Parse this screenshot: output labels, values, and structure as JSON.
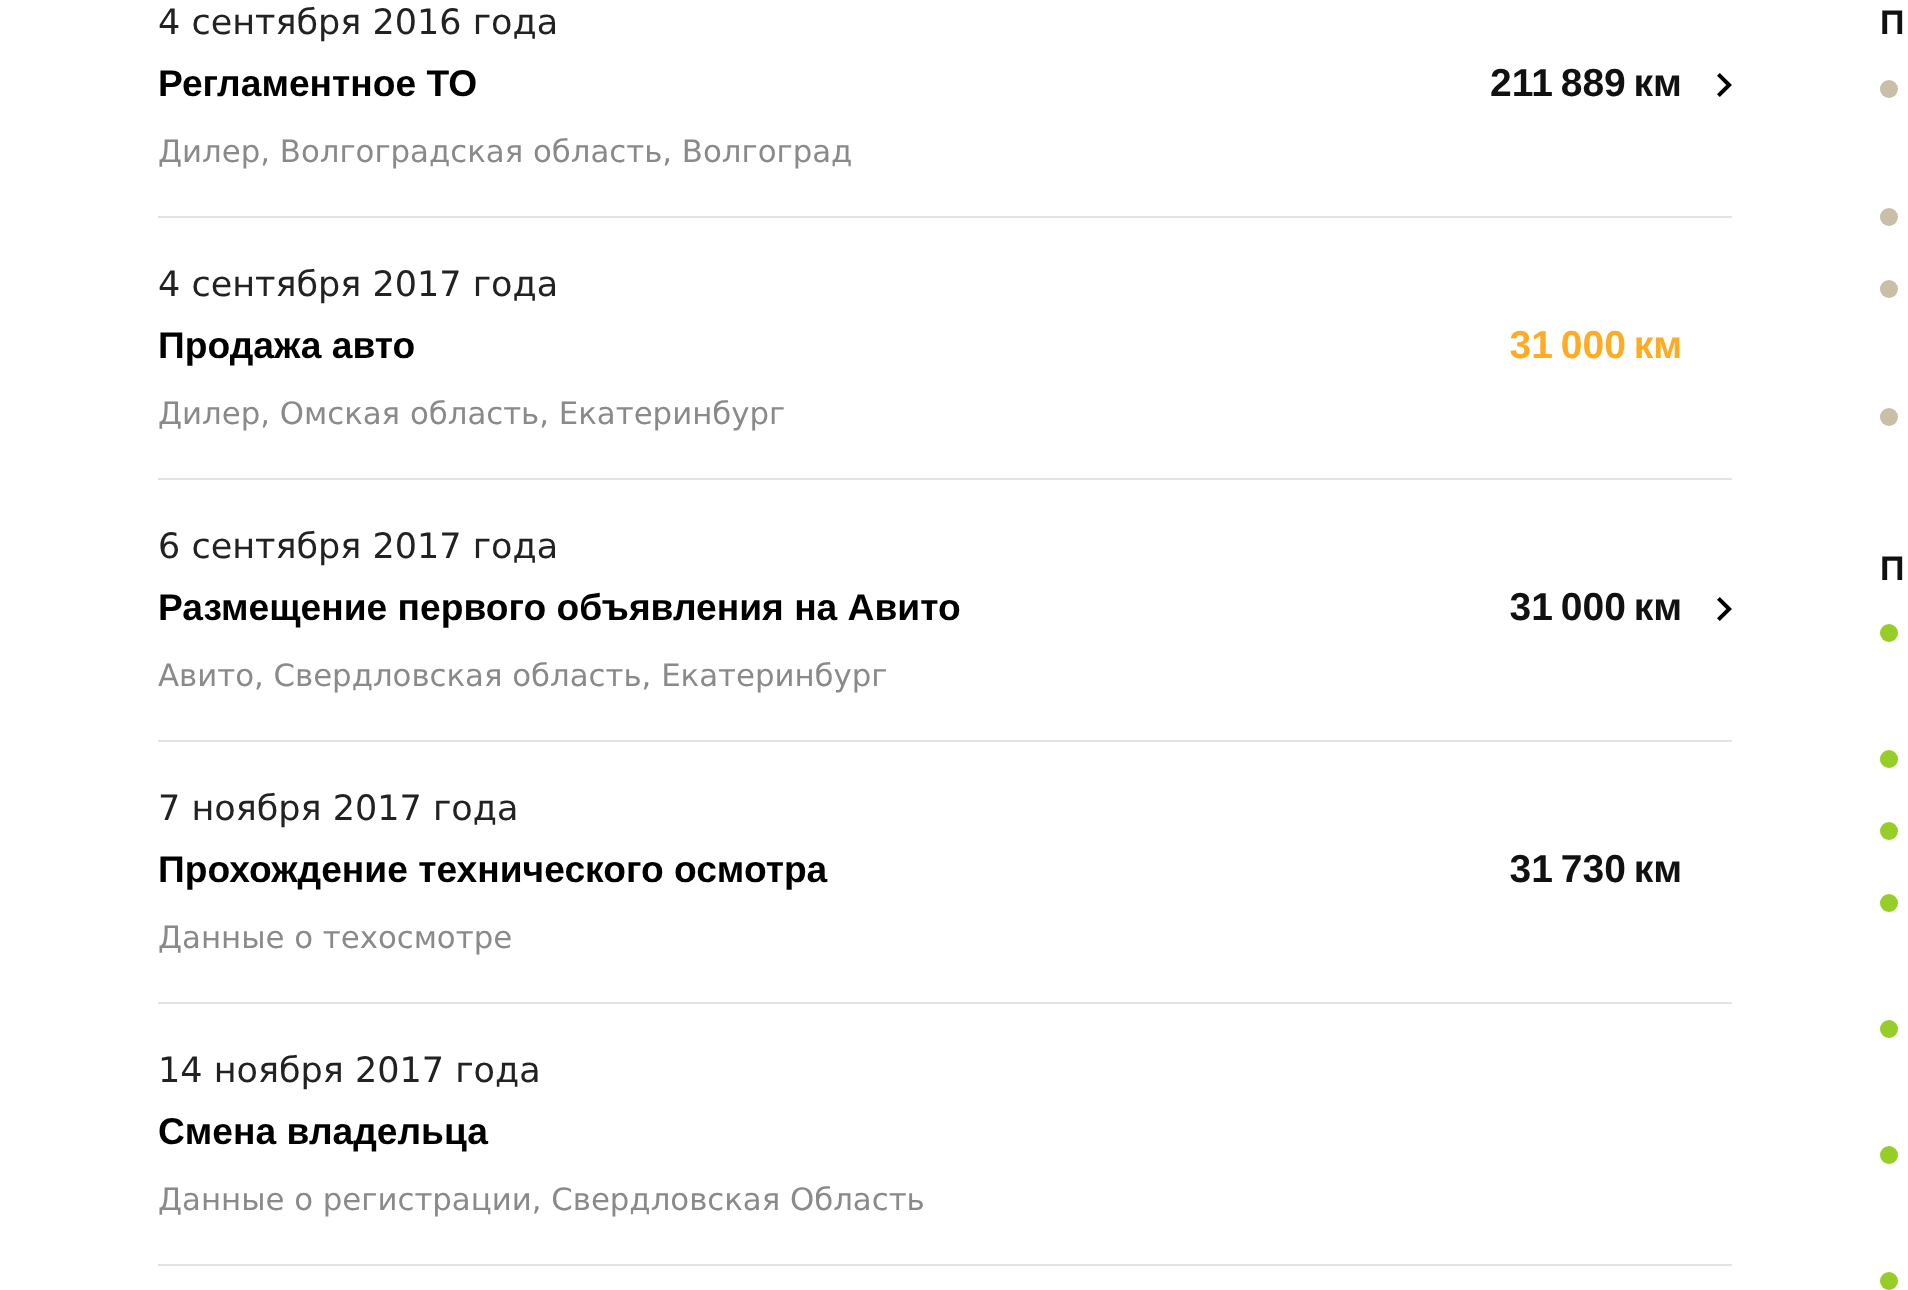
{
  "history": [
    {
      "date": "4 сентября 2016 года",
      "title": "Регламентное ТО",
      "source": "Дилер, Волгоградская область, Волгоград",
      "mileage": "211 889 км",
      "highlighted": false,
      "link": true
    },
    {
      "date": "4 сентября 2017 года",
      "title": "Продажа авто",
      "source": "Дилер, Омская область, Екатеринбург",
      "mileage": "31 000 км",
      "highlighted": true,
      "link": false
    },
    {
      "date": "6 сентября 2017 года",
      "title": "Размещение первого объявления на Авито",
      "source": "Авито, Свердловская область, Екатеринбург",
      "mileage": "31 000 км",
      "highlighted": false,
      "link": true
    },
    {
      "date": "7 ноября 2017 года",
      "title": "Прохождение технического осмотра",
      "source": "Данные о техосмотре",
      "mileage": "31 730 км",
      "highlighted": false,
      "link": false
    },
    {
      "date": "14 ноября 2017 года",
      "title": "Смена владельца",
      "source": "Данные о регистрации, Свердловская Область",
      "link": false
    }
  ],
  "sidebar": {
    "groups": [
      {
        "heading": "П",
        "items": [
          {
            "kind": "tall",
            "color": "#c8bfa6"
          },
          {
            "kind": "short",
            "color": "#c8bfa6"
          },
          {
            "kind": "tall",
            "color": "#c8bfa6"
          },
          {
            "kind": "tall",
            "color": "#c8bfa6"
          }
        ]
      },
      {
        "heading": "П",
        "items": [
          {
            "kind": "tall",
            "color": "#97cd27"
          },
          {
            "kind": "short",
            "color": "#97cd27"
          },
          {
            "kind": "short",
            "color": "#97cd27"
          },
          {
            "kind": "tall",
            "color": "#97cd27"
          },
          {
            "kind": "tall",
            "color": "#97cd27"
          },
          {
            "kind": "tall",
            "color": "#97cd27"
          },
          {
            "kind": "tall",
            "color": "#97cd27"
          }
        ]
      }
    ]
  }
}
